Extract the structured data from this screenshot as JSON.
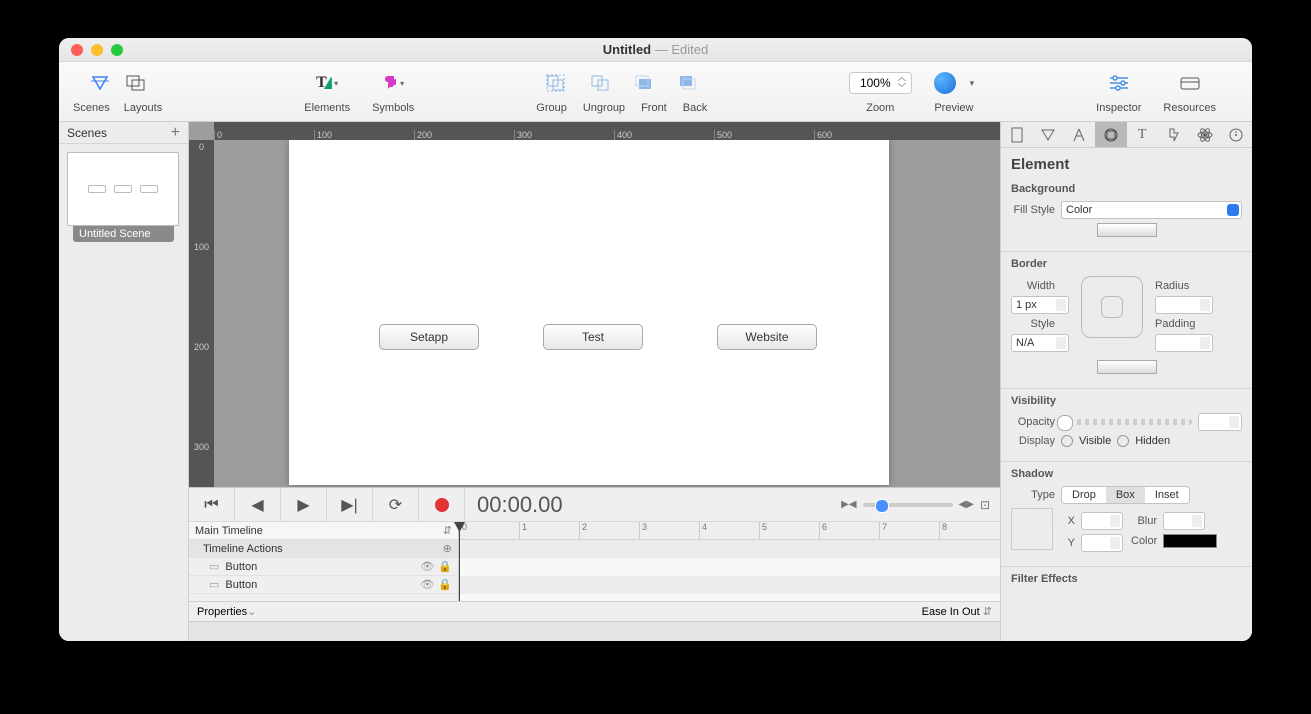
{
  "window": {
    "title": "Untitled",
    "subtitle": "Edited"
  },
  "toolbar": {
    "scenes": "Scenes",
    "layouts": "Layouts",
    "elements": "Elements",
    "symbols": "Symbols",
    "group": "Group",
    "ungroup": "Ungroup",
    "front": "Front",
    "back": "Back",
    "zoom": "Zoom",
    "zoom_value": "100%",
    "preview": "Preview",
    "inspector": "Inspector",
    "resources": "Resources"
  },
  "scenes_panel": {
    "header": "Scenes",
    "scene1": "Untitled Scene"
  },
  "ruler_h": [
    "0",
    "100",
    "200",
    "300",
    "400",
    "500",
    "600"
  ],
  "ruler_v": [
    "0",
    "100",
    "200",
    "300"
  ],
  "stage": {
    "btn1": "Setapp",
    "btn2": "Test",
    "btn3": "Website"
  },
  "timeline": {
    "time": "00:00.00",
    "name": "Main Timeline",
    "actions": "Timeline Actions",
    "item1": "Button",
    "item2": "Button",
    "properties": "Properties",
    "ease": "Ease In Out",
    "ticks": [
      "0",
      "1",
      "2",
      "3",
      "4",
      "5",
      "6",
      "7",
      "8"
    ]
  },
  "inspector": {
    "title": "Element",
    "background": {
      "label": "Background",
      "fill_style": "Fill Style",
      "fill_value": "Color"
    },
    "border": {
      "label": "Border",
      "width": "Width",
      "width_value": "1 px",
      "style": "Style",
      "style_value": "N/A",
      "radius": "Radius",
      "padding": "Padding"
    },
    "visibility": {
      "label": "Visibility",
      "opacity": "Opacity",
      "display": "Display",
      "visible": "Visible",
      "hidden": "Hidden"
    },
    "shadow": {
      "label": "Shadow",
      "type": "Type",
      "drop": "Drop",
      "box": "Box",
      "inset": "Inset",
      "x": "X",
      "y": "Y",
      "blur": "Blur",
      "color": "Color"
    },
    "filter": "Filter Effects"
  }
}
